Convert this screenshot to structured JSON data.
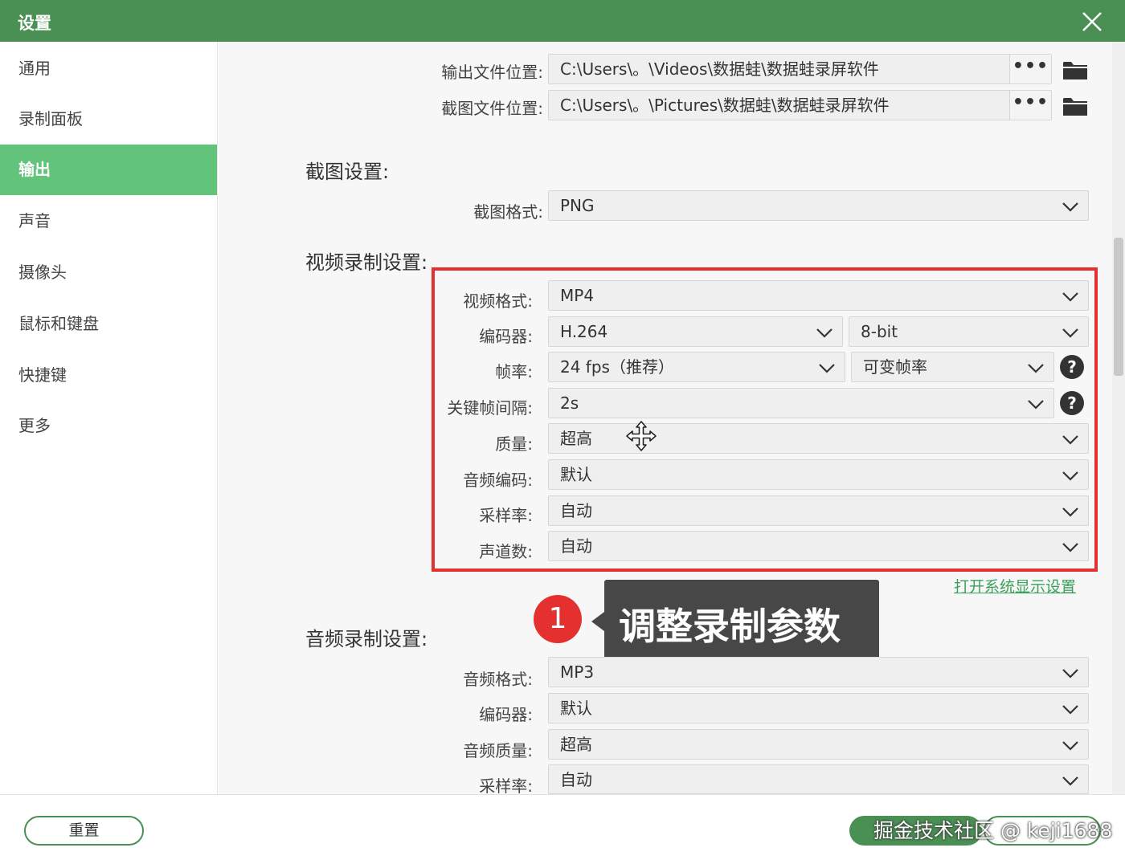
{
  "window": {
    "title": "设置"
  },
  "sidebar": {
    "items": [
      {
        "label": "通用"
      },
      {
        "label": "录制面板"
      },
      {
        "label": "输出",
        "active": true
      },
      {
        "label": "声音"
      },
      {
        "label": "摄像头"
      },
      {
        "label": "鼠标和键盘"
      },
      {
        "label": "快捷键"
      },
      {
        "label": "更多"
      }
    ]
  },
  "output_paths": {
    "video_label": "输出文件位置:",
    "video_path": "C:\\Users\\。\\Videos\\数据蛙\\数据蛙录屏软件",
    "shot_label": "截图文件位置:",
    "shot_path": "C:\\Users\\。\\Pictures\\数据蛙\\数据蛙录屏软件",
    "browse": "•••"
  },
  "screenshot_settings": {
    "title": "截图设置:",
    "format_label": "截图格式:",
    "format_value": "PNG"
  },
  "video_settings": {
    "title": "视频录制设置:",
    "format_label": "视频格式:",
    "format_value": "MP4",
    "encoder_label": "编码器:",
    "encoder_value": "H.264",
    "bitdepth_value": "8-bit",
    "fps_label": "帧率:",
    "fps_value": "24 fps（推荐）",
    "fps_mode_value": "可变帧率",
    "keyframe_label": "关键帧间隔:",
    "keyframe_value": "2s",
    "quality_label": "质量:",
    "quality_value": "超高",
    "audio_codec_label": "音频编码:",
    "audio_codec_value": "默认",
    "samplerate_label": "采样率:",
    "samplerate_value": "自动",
    "channels_label": "声道数:",
    "channels_value": "自动",
    "help": "?"
  },
  "display_link": "打开系统显示设置",
  "annotation": {
    "badge": "1",
    "text": "调整录制参数"
  },
  "audio_settings": {
    "title": "音频录制设置:",
    "format_label": "音频格式:",
    "format_value": "MP3",
    "encoder_label": "编码器:",
    "encoder_value": "默认",
    "quality_label": "音频质量:",
    "quality_value": "超高",
    "samplerate_label": "采样率:",
    "samplerate_value": "自动"
  },
  "footer": {
    "reset_label": "重置",
    "watermark": "掘金技术社区 @ keji1688"
  },
  "colors": {
    "titlebar": "#4a8f53",
    "active_nav": "#62c37b",
    "highlight_border": "#e53030",
    "callout_bg": "#474747",
    "link": "#3aa05a"
  },
  "icons": [
    "close-icon",
    "folder-icon",
    "chevron-down-icon",
    "help-icon",
    "move-cursor-icon"
  ]
}
